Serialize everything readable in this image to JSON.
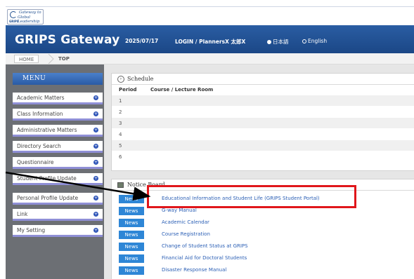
{
  "logo": {
    "line1": "Gateway to",
    "line2": "Global Leadership",
    "abbr": "GRIPS"
  },
  "header": {
    "brand": "GRIPS Gateway",
    "date": "2025/07/17",
    "login": "LOGIN / PlannersX 太郎X",
    "lang_ja": "日本語",
    "lang_en": "English",
    "selected_lang": "ja"
  },
  "breadcrumb": {
    "home": "HOME",
    "current": "TOP"
  },
  "menu": {
    "title": "MENU",
    "items": [
      {
        "label": "Academic Matters"
      },
      {
        "label": "Class Information"
      },
      {
        "label": "Administrative Matters"
      },
      {
        "label": "Directory Search"
      },
      {
        "label": "Questionnaire"
      },
      {
        "label": "Student Profile Update"
      },
      {
        "label": "Personal Profile Update"
      },
      {
        "label": "Link"
      },
      {
        "label": "My Setting"
      }
    ]
  },
  "schedule": {
    "title": "Schedule",
    "col_period": "Period",
    "col_course": "Course / Lecture Room",
    "periods": [
      "1",
      "2",
      "3",
      "4",
      "5",
      "6"
    ]
  },
  "notice": {
    "title": "Notice Board",
    "badge": "News",
    "items": [
      "Educational Information and Student Life (GRIPS Student Portal)",
      "G-way Manual",
      "Academic Calendar",
      "Course Registration",
      "Change of Student Status at GRIPS",
      "Financial Aid for Doctoral Students",
      "Disaster Response Manual"
    ]
  },
  "colors": {
    "header_blue": "#1b4786",
    "menu_blue": "#2a5ba5",
    "news_badge": "#2e86d6",
    "highlight_red": "#e0161b"
  }
}
